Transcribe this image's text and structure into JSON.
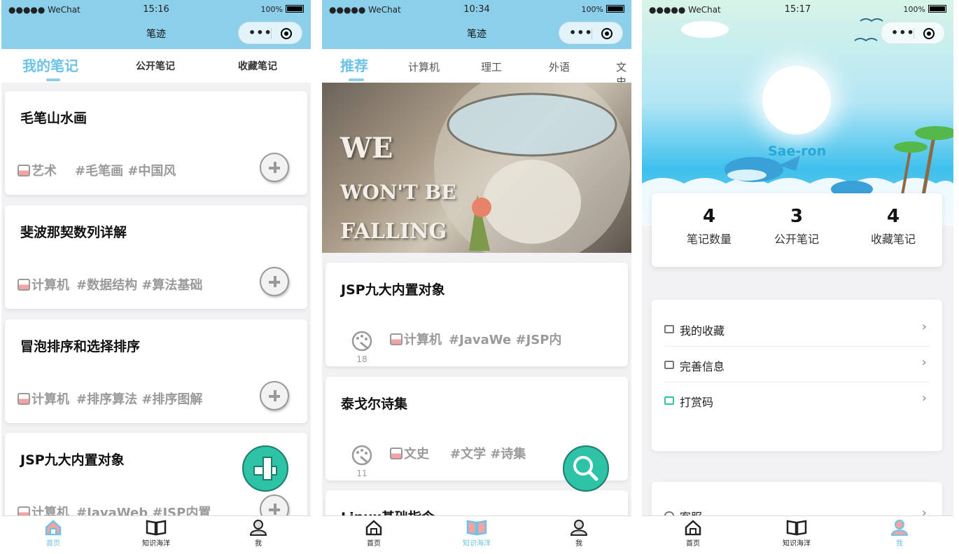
{
  "colors": {
    "nav_bg": "#8ccfea",
    "accent": "#6cc3e6",
    "fab": "#2ec2a6"
  },
  "status1": {
    "carrier": "●●●●● WeChat",
    "time": "15:16",
    "battery": "100%"
  },
  "status2": {
    "carrier": "●●●●● WeChat",
    "time": "10:34",
    "battery": "100%"
  },
  "status3": {
    "carrier": "●●●●● WeChat",
    "time": "15:17",
    "battery": "100%"
  },
  "app_title": "笔迹",
  "p1": {
    "tabs": [
      "我的笔记",
      "公开笔记",
      "收藏笔记"
    ],
    "notes": [
      {
        "title": "毛笔山水画",
        "category": "艺术",
        "tags": "#毛笔画 #中国风"
      },
      {
        "title": "斐波那契数列详解",
        "category": "计算机",
        "tags": "#数据结构 #算法基础"
      },
      {
        "title": "冒泡排序和选择排序",
        "category": "计算机",
        "tags": "#排序算法 #排序图解"
      },
      {
        "title": "JSP九大内置对象",
        "category": "计算机",
        "tags": "#JavaWeb #JSP内置"
      }
    ]
  },
  "p2": {
    "tabs": [
      "推荐",
      "计算机",
      "理工",
      "外语",
      "文史"
    ],
    "banner": {
      "line1": "WE",
      "line2": "WON'T BE",
      "line3": "FALLING"
    },
    "notes": [
      {
        "title": "JSP九大内置对象",
        "category": "计算机",
        "tags": "#JavaWe #JSP内",
        "views": "18"
      },
      {
        "title": "泰戈尔诗集",
        "category": "文史",
        "tags": "#文学 #诗集",
        "views": "11"
      },
      {
        "title": "Linux基础指令"
      }
    ]
  },
  "p3": {
    "username": "Sae-ron",
    "stats": [
      {
        "value": "4",
        "label": "笔记数量"
      },
      {
        "value": "3",
        "label": "公开笔记"
      },
      {
        "value": "4",
        "label": "收藏笔记"
      }
    ],
    "menu": [
      "我的收藏",
      "完善信息",
      "打赏码"
    ],
    "menu2": [
      "客服"
    ]
  },
  "tabbar": [
    "首页",
    "知识海洋",
    "我"
  ],
  "icons": [
    "home-icon",
    "book-icon",
    "user-icon",
    "search-icon",
    "plus-icon",
    "palette-icon",
    "chevron-right-icon"
  ]
}
